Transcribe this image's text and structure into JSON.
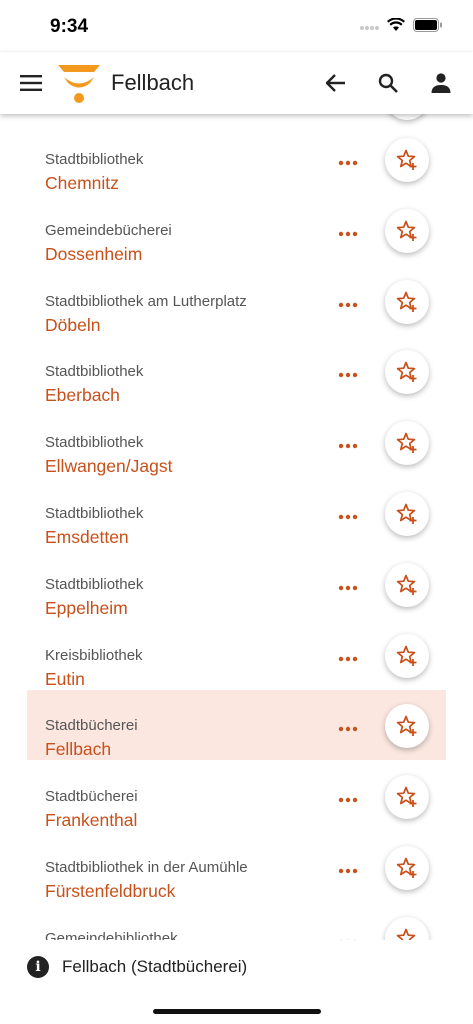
{
  "status": {
    "time": "9:34"
  },
  "header": {
    "title": "Fellbach"
  },
  "libraries": [
    {
      "type": "Stadtbibliothek",
      "city": "Chemnitz",
      "selected": false
    },
    {
      "type": "Gemeindebücherei",
      "city": "Dossenheim",
      "selected": false
    },
    {
      "type": "Stadtbibliothek am Lutherplatz",
      "city": "Döbeln",
      "selected": false
    },
    {
      "type": "Stadtbibliothek",
      "city": "Eberbach",
      "selected": false
    },
    {
      "type": "Stadtbibliothek",
      "city": "Ellwangen/Jagst",
      "selected": false
    },
    {
      "type": "Stadtbibliothek",
      "city": "Emsdetten",
      "selected": false
    },
    {
      "type": "Stadtbibliothek",
      "city": "Eppelheim",
      "selected": false
    },
    {
      "type": "Kreisbibliothek",
      "city": "Eutin",
      "selected": false
    },
    {
      "type": "Stadtbücherei",
      "city": "Fellbach",
      "selected": true
    },
    {
      "type": "Stadtbücherei",
      "city": "Frankenthal",
      "selected": false
    },
    {
      "type": "Stadtbibliothek in der Aumühle",
      "city": "Fürstenfeldbruck",
      "selected": false
    },
    {
      "type": "Gemeindebibliothek",
      "city": "",
      "selected": false
    }
  ],
  "footer": {
    "info_text": "Fellbach (Stadtbücherei)"
  },
  "colors": {
    "accent": "#c8501a",
    "selected_bg": "#fbe7e0",
    "logo": "#f39a1e"
  },
  "icons": [
    "menu-icon",
    "logo-icon",
    "back-arrow-icon",
    "search-icon",
    "account-icon",
    "more-dots-icon",
    "star-plus-icon",
    "info-icon"
  ]
}
